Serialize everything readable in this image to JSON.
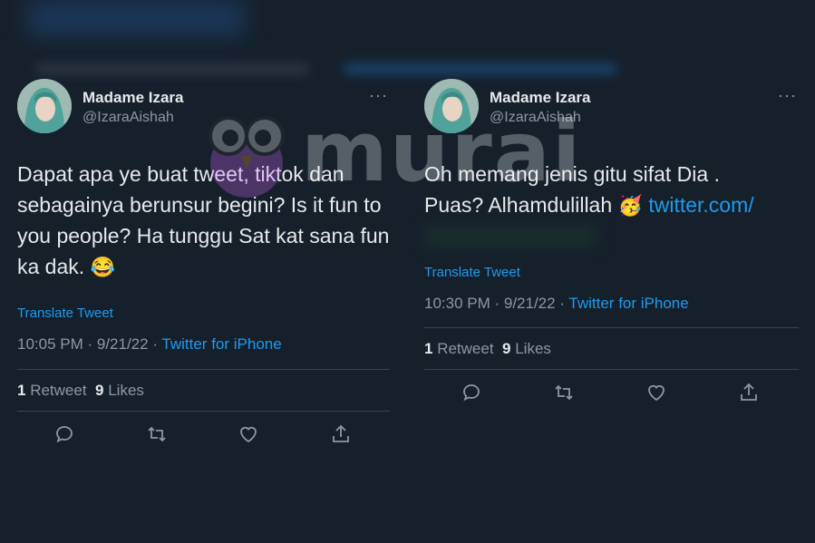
{
  "tweets": [
    {
      "name": "Madame Izara",
      "handle": "@IzaraAishah",
      "more": "···",
      "text": "Dapat apa ye buat tweet, tiktok dan sebagainya berunsur begini? Is it fun to you people? Ha tunggu Sat kat sana fun ka dak.",
      "emoji": "😂",
      "translate": "Translate Tweet",
      "time": "10:05 PM · 9/21/22 · ",
      "source": "Twitter for iPhone",
      "retweets": "1",
      "retweets_label": " Retweet",
      "likes": "9",
      "likes_label": " Likes"
    },
    {
      "name": "Madame Izara",
      "handle": "@IzaraAishah",
      "more": "···",
      "text_line1": "Oh memang jenis gitu sifat Dia .",
      "text_line2": "Puas? Alhamdulillah",
      "emoji": "🥳",
      "link": "twitter.com/",
      "translate": "Translate Tweet",
      "time": "10:30 PM · 9/21/22 · ",
      "source": "Twitter for iPhone",
      "retweets": "1",
      "retweets_label": " Retweet",
      "likes": "9",
      "likes_label": " Likes"
    }
  ],
  "watermark": {
    "text": "murai"
  },
  "icons": [
    "more-icon",
    "reply-icon",
    "retweet-icon",
    "like-icon",
    "share-icon"
  ],
  "colors": {
    "background": "#15202b",
    "accent": "#1d9bf0",
    "muted": "#8b98a5",
    "text": "#e7e9ea"
  }
}
